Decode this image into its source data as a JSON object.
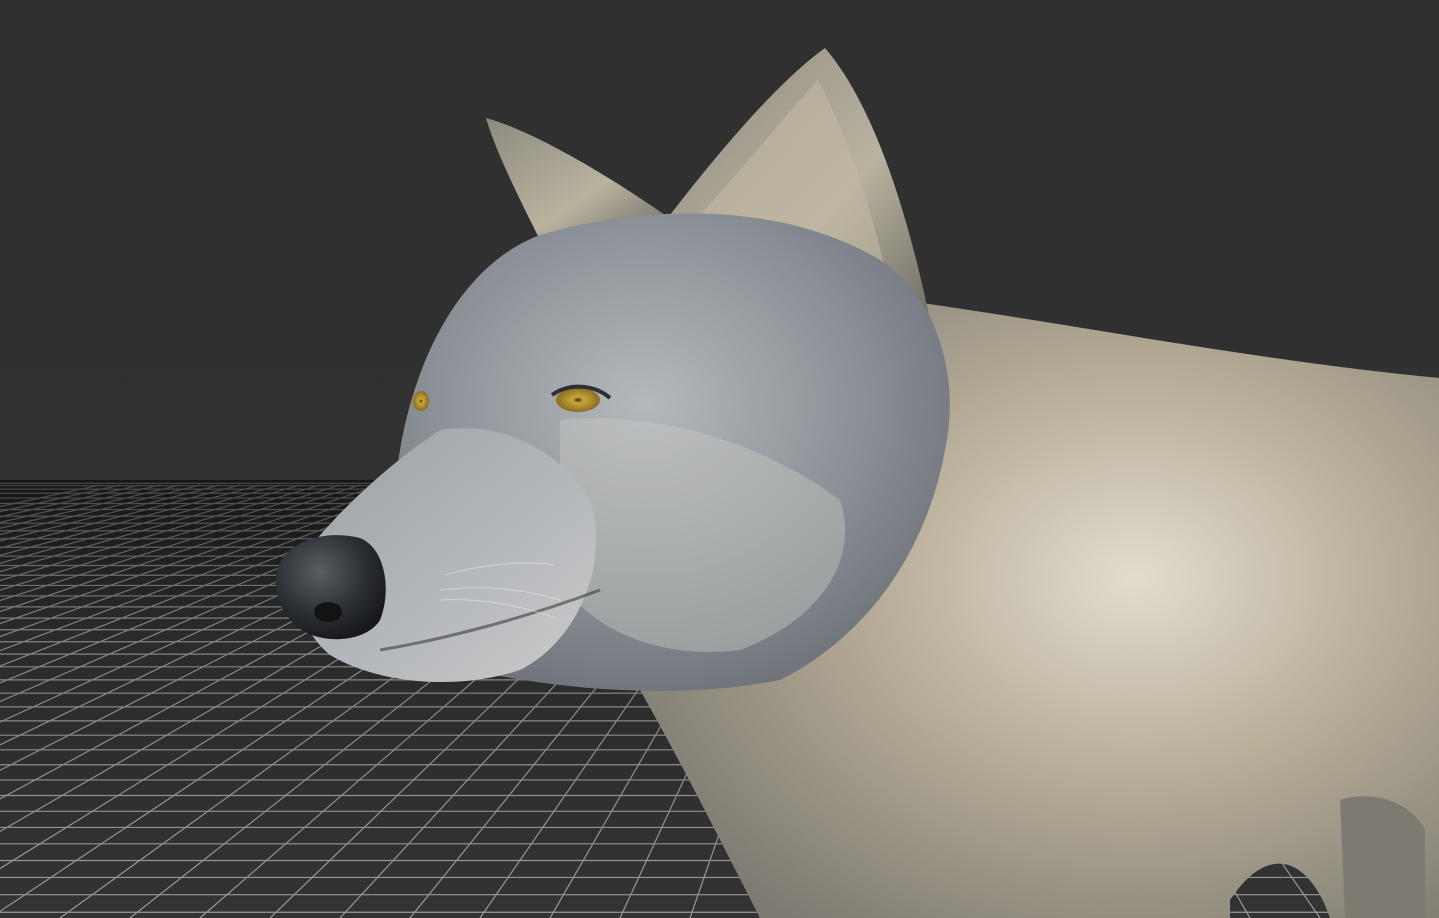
{
  "viewport": {
    "background_color": "#313131",
    "grid_line_color": "#9a9a9a",
    "grid_visible": true
  },
  "model": {
    "subject": "wolf-3d-model",
    "fur_colors": [
      "#8a8f96",
      "#b8ab94",
      "#d7d2c6",
      "#6f7479"
    ],
    "eye_color": "#c9a83a",
    "nose_color": "#2b2e33"
  }
}
